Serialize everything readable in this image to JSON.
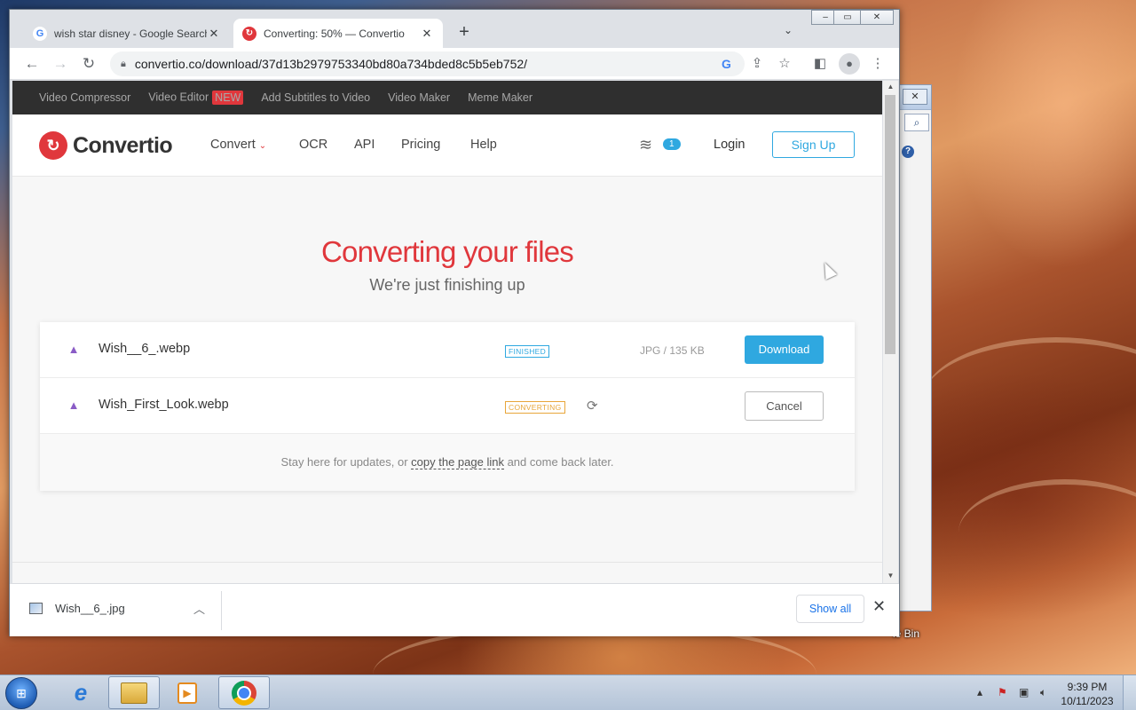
{
  "browser": {
    "tabs": [
      {
        "title": "wish star disney - Google Search",
        "active": false,
        "icon": "google-icon"
      },
      {
        "title": "Converting: 50% — Convertio",
        "active": true,
        "icon": "convertio-icon"
      }
    ],
    "url": "convertio.co/download/37d13b2979753340bd80a734bded8c5b5eb752/"
  },
  "site": {
    "topbar": [
      "Video Compressor",
      "Video Editor",
      "Add Subtitles to Video",
      "Video Maker",
      "Meme Maker"
    ],
    "new_badge": "NEW",
    "logo": "Convertio",
    "nav": {
      "convert": "Convert",
      "ocr": "OCR",
      "api": "API",
      "pricing": "Pricing",
      "help": "Help"
    },
    "queue_count": "1",
    "login": "Login",
    "signup": "Sign Up",
    "accent_color": "#e0373c",
    "link_color": "#2fa8e0"
  },
  "main": {
    "title": "Converting your files",
    "subtitle": "We're just finishing up",
    "files": [
      {
        "name": "Wish__6_.webp",
        "status": "FINISHED",
        "meta": "JPG / 135 KB",
        "action": "Download"
      },
      {
        "name": "Wish_First_Look.webp",
        "status": "CONVERTING",
        "meta": "",
        "action": "Cancel"
      }
    ],
    "stay_prefix": "Stay here for updates, or",
    "stay_link": "copy the page link",
    "stay_suffix": "and come back later."
  },
  "downloads": {
    "file": "Wish__6_.jpg",
    "show_all": "Show all"
  },
  "desktop": {
    "recycle_bin_label": "le Bin",
    "clock_time": "9:39 PM",
    "clock_date": "10/11/2023"
  }
}
